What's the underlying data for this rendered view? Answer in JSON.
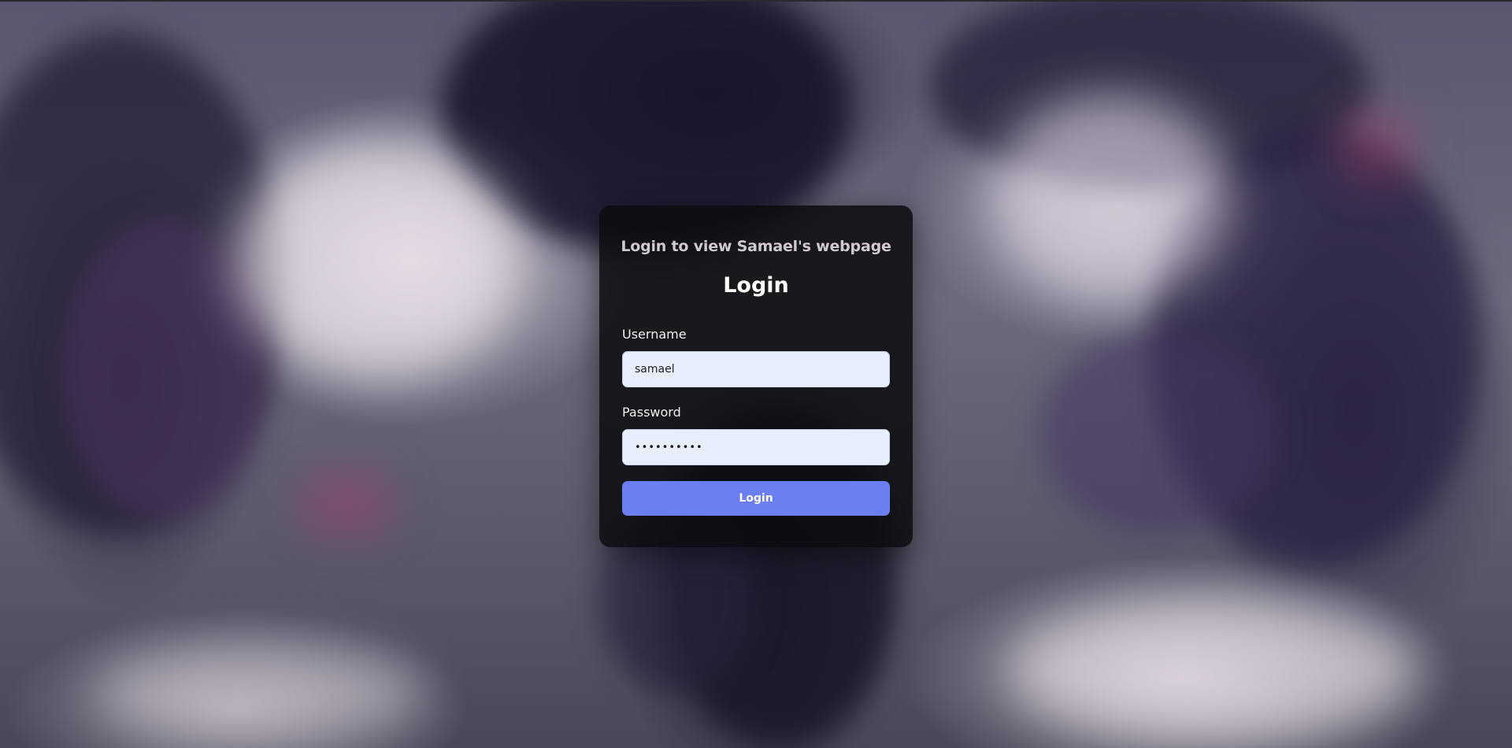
{
  "page": {
    "background_image": "dark-samurai-storm-artwork"
  },
  "login": {
    "subtitle": "Login to view Samael's webpage",
    "title": "Login",
    "username_label": "Username",
    "username_value": "samael",
    "password_label": "Password",
    "password_value": "••••••••••",
    "button_label": "Login"
  },
  "colors": {
    "card_background": "#0a0a0e",
    "input_background": "#e8eefc",
    "button_background": "#6b7ff0",
    "subtitle_text": "#d0c9ce"
  }
}
